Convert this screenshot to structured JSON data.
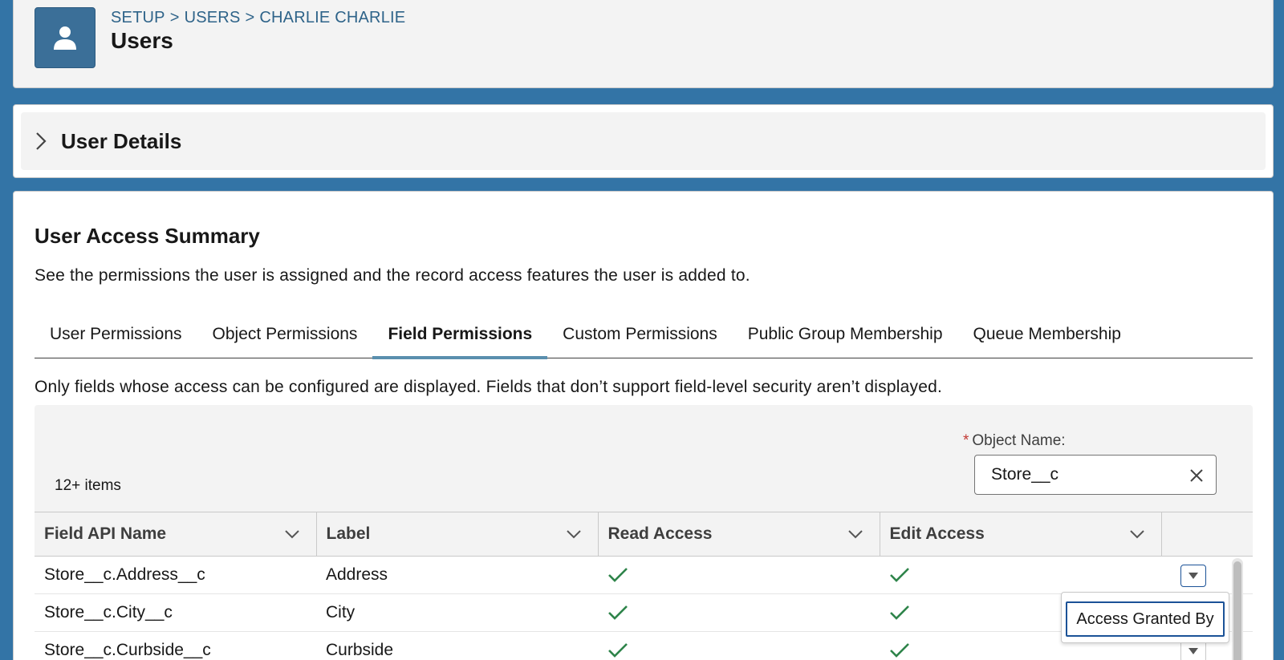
{
  "header": {
    "breadcrumb": [
      "SETUP",
      "USERS",
      "CHARLIE CHARLIE"
    ],
    "breadcrumb_separator": ">",
    "title": "Users",
    "icon": "user-icon"
  },
  "details": {
    "title": "User Details",
    "icon": "chevron-right-icon"
  },
  "summary": {
    "title": "User Access Summary",
    "description": "See the permissions the user is assigned and the record access features the user is added to.",
    "tabs": [
      {
        "label": "User Permissions",
        "active": false
      },
      {
        "label": "Object Permissions",
        "active": false
      },
      {
        "label": "Field Permissions",
        "active": true
      },
      {
        "label": "Custom Permissions",
        "active": false
      },
      {
        "label": "Public Group Membership",
        "active": false
      },
      {
        "label": "Queue Membership",
        "active": false
      }
    ],
    "field_note": "Only fields whose access can be configured are displayed. Fields that don’t support field-level security aren’t displayed."
  },
  "table": {
    "object_label": "Object Name:",
    "required_marker": "*",
    "object_value": "Store__c",
    "item_count": "12+ items",
    "columns": [
      "Field API Name",
      "Label",
      "Read Access",
      "Edit Access"
    ],
    "rows": [
      {
        "api_name": "Store__c.Address__c",
        "label": "Address",
        "read": true,
        "edit": true
      },
      {
        "api_name": "Store__c.City__c",
        "label": "City",
        "read": true,
        "edit": true
      },
      {
        "api_name": "Store__c.Curbside__c",
        "label": "Curbside",
        "read": true,
        "edit": true
      }
    ]
  },
  "row_menu": {
    "item": "Access Granted By"
  },
  "colors": {
    "brand_blue": "#3374a6",
    "check_green": "#2e844a",
    "focus_blue": "#1b5297",
    "breadcrumb": "#2e6389"
  }
}
